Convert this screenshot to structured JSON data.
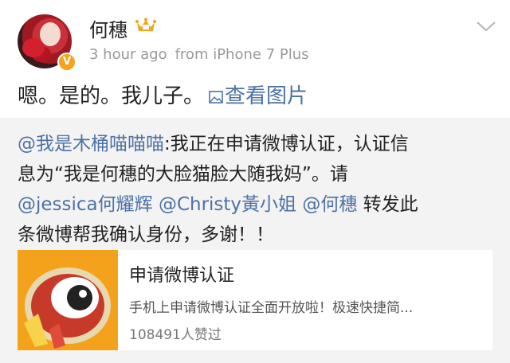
{
  "post": {
    "author": "何穗",
    "time": "3 hour ago",
    "source": "from iPhone 7 Plus",
    "text": "嗯。是的。我儿子。",
    "view_pic_label": "查看图片",
    "verified_badge": "V"
  },
  "repost": {
    "mention_user": "@我是木桶喵喵喵",
    "line1_rest": ":我正在申请微博认证，认证信",
    "line2": "息为“我是何穗的大脸猫脸大随我妈”。请",
    "mention_jessica": "@jessica何耀辉",
    "mention_christy": "@Christy黃小姐",
    "mention_hesui": "@何穗",
    "line3_rest": " 转发此",
    "line4": "条微博帮我确认身份，多谢！！"
  },
  "card": {
    "title": "申请微博认证",
    "description": "手机上申请微博认证全面开放啦！极速快捷简...",
    "likes": "108491人赞过"
  },
  "colors": {
    "link": "#4c72a5",
    "repost_bg": "#f3f3f3",
    "badge": "#f4a41d",
    "thumb_bg": "#f4a21b"
  },
  "icons": [
    "crown-icon",
    "chevron-down-icon",
    "picture-icon",
    "weibo-mascot-icon"
  ]
}
